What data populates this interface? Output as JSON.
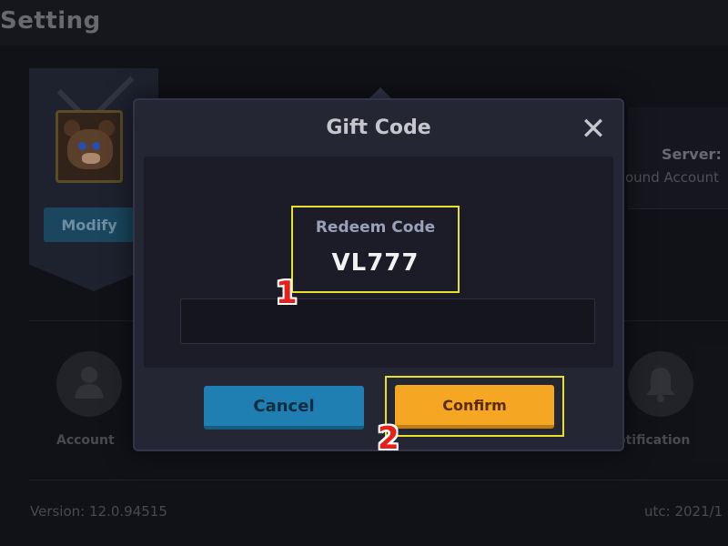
{
  "background": {
    "page_title": "Setting",
    "modify_label": "Modify",
    "server_label": "Server:",
    "bound_label": "ound Account",
    "account_label": "Account",
    "notification_label": "otification",
    "version_label": "Version: 12.0.94515",
    "utc_label": "utc: 2021/1"
  },
  "dialog": {
    "title": "Gift Code",
    "close_symbol": "✕",
    "redeem_label": "Redeem Code",
    "code_value": "VL777",
    "cancel_label": "Cancel",
    "confirm_label": "Confirm"
  },
  "annotations": {
    "step1": "1",
    "step2": "2",
    "highlight_color": "#e8e02c",
    "step_color": "#e8201a"
  },
  "colors": {
    "cancel": "#1f7fb2",
    "confirm": "#f5a623",
    "dialog_bg": "#242634"
  }
}
